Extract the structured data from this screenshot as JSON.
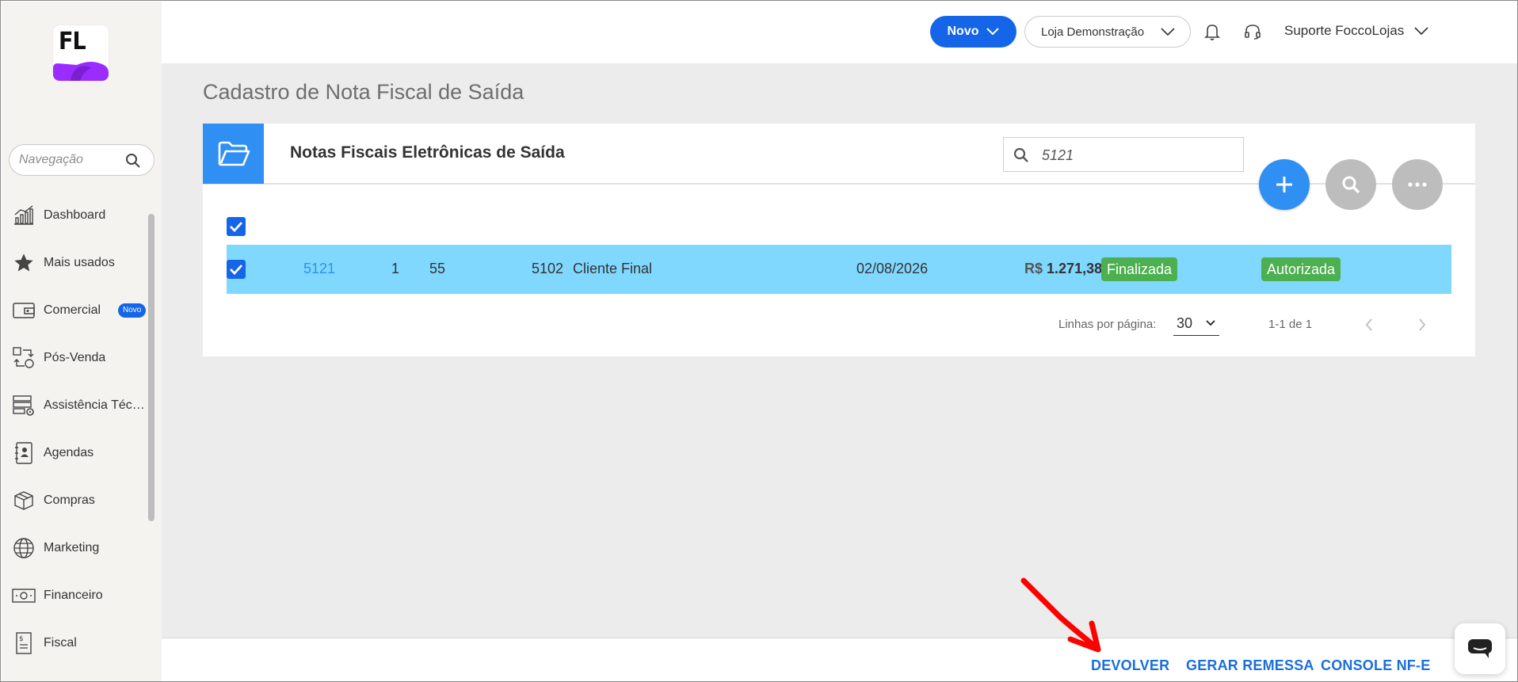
{
  "brand": {
    "logo_text": "FL",
    "logo_color": "#9b2cff"
  },
  "sidebar": {
    "search_placeholder": "Navegação",
    "items": [
      {
        "label": "Dashboard",
        "icon": "chart-line-icon"
      },
      {
        "label": "Mais usados",
        "icon": "star-icon"
      },
      {
        "label": "Comercial",
        "icon": "wallet-icon",
        "badge": "Novo"
      },
      {
        "label": "Pós-Venda",
        "icon": "exchange-icon"
      },
      {
        "label": "Assistência Técn...",
        "icon": "server-gear-icon"
      },
      {
        "label": "Agendas",
        "icon": "contact-book-icon"
      },
      {
        "label": "Compras",
        "icon": "box-icon"
      },
      {
        "label": "Marketing",
        "icon": "globe-icon"
      },
      {
        "label": "Financeiro",
        "icon": "money-icon"
      },
      {
        "label": "Fiscal",
        "icon": "receipt-icon"
      }
    ]
  },
  "header": {
    "new_button": "Novo",
    "store": "Loja Demonstração",
    "user": "Suporte FoccoLojas"
  },
  "page": {
    "title": "Cadastro de Nota Fiscal de Saída"
  },
  "card": {
    "title": "Notas Fiscais Eletrônicas de Saída",
    "search_value": "5121"
  },
  "table": {
    "rows": [
      {
        "number": "5121",
        "series": "1",
        "model": "55",
        "cfop": "5102",
        "customer": "Cliente Final",
        "date": "02/08/2026",
        "currency": "R$",
        "amount": "1.271,38",
        "status": "Finalizada",
        "sefaz_status": "Autorizada",
        "selected": true
      }
    ]
  },
  "pagination": {
    "rows_label": "Linhas por página:",
    "rows_value": "30",
    "range": "1-1 de 1"
  },
  "footer_actions": {
    "devolver": "DEVOLVER",
    "gerar_remessa": "GERAR REMESSA",
    "console": "CONSOLE NF-E"
  },
  "colors": {
    "primary": "#1565e8",
    "accent": "#2f8ff3",
    "row_highlight": "#80d8ff",
    "status_green": "#4caf50",
    "annotation_arrow": "#ff0000"
  }
}
